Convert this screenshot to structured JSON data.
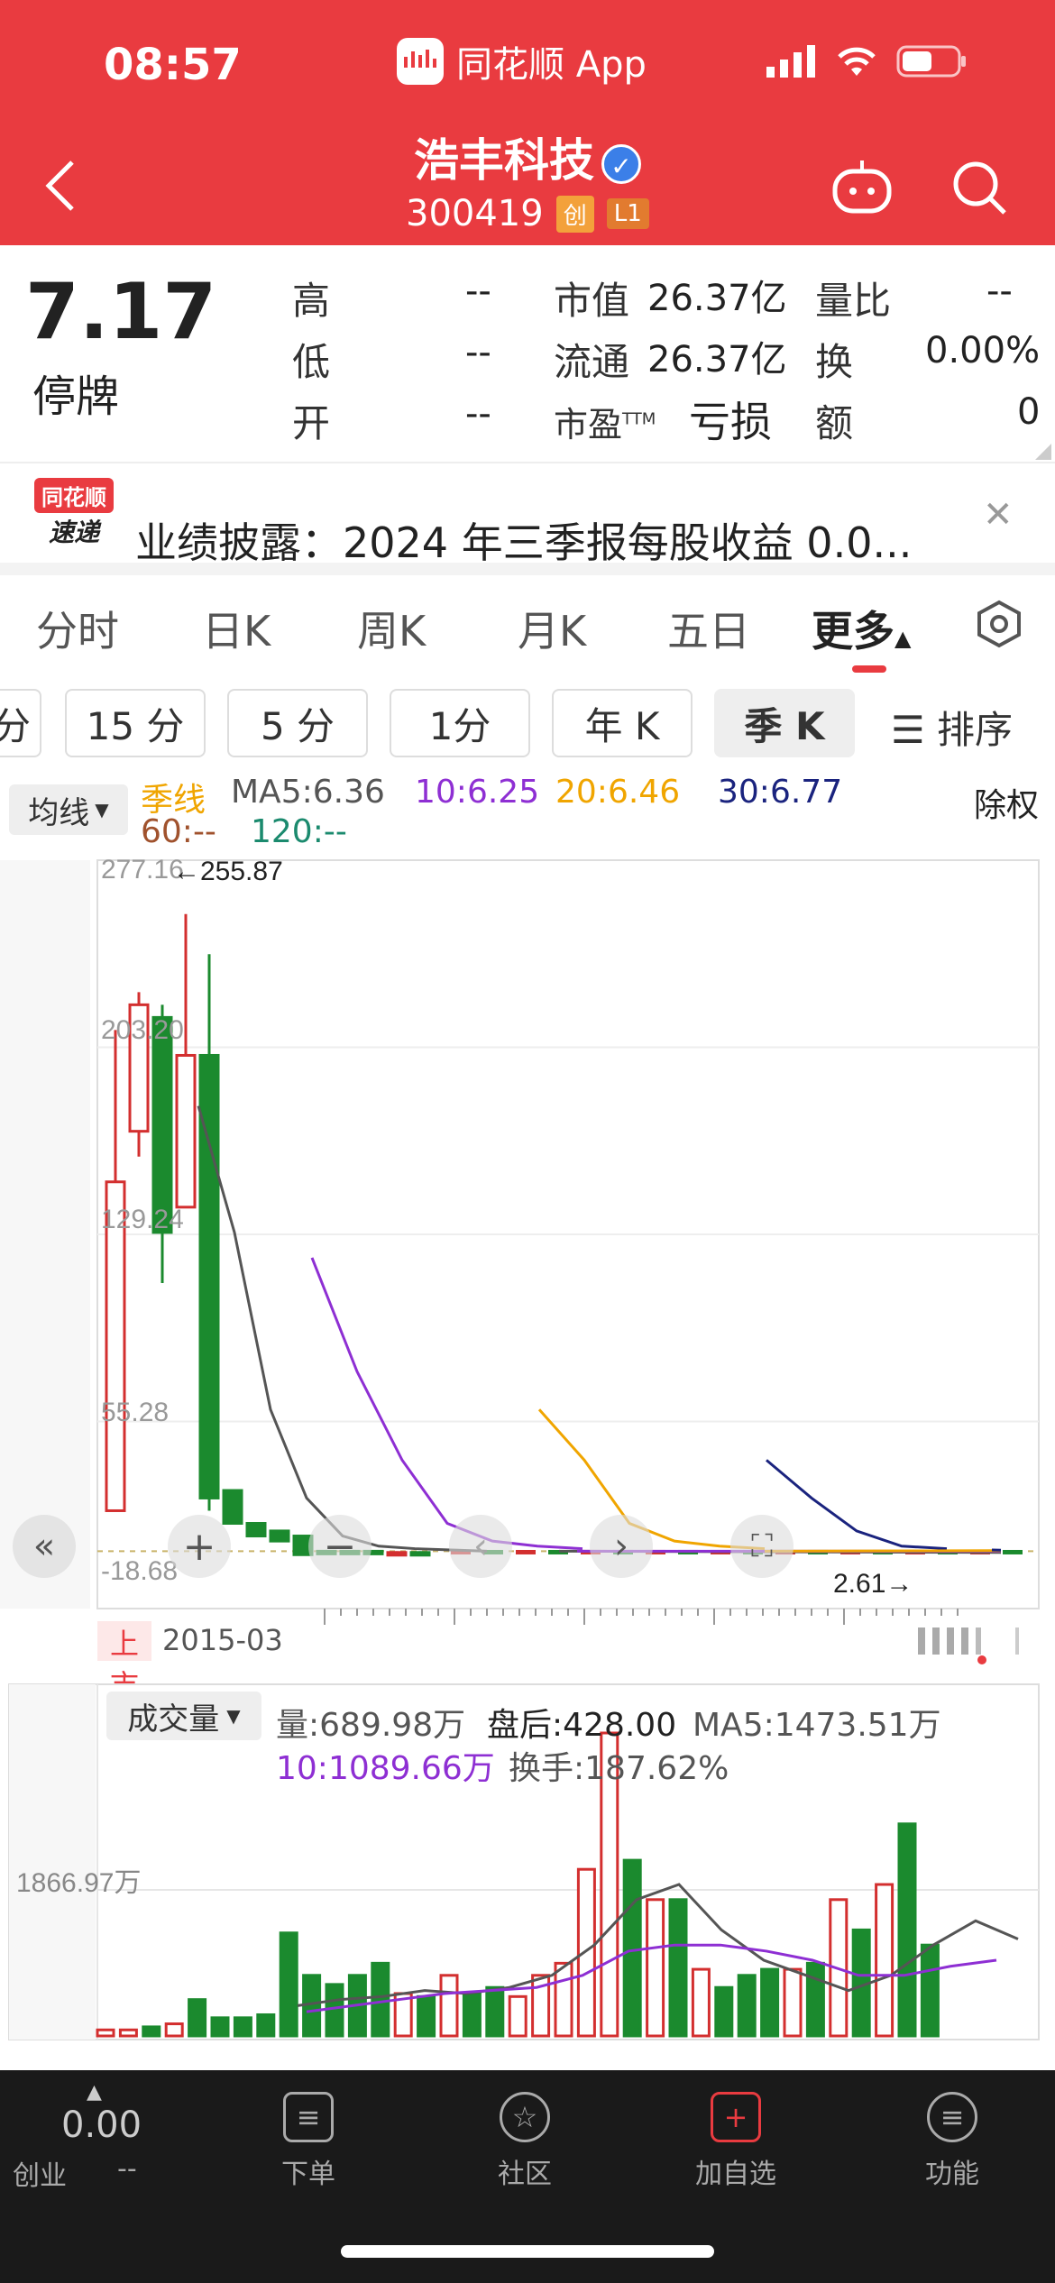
{
  "status_bar": {
    "time": "08:57",
    "app_name": "同花顺 App"
  },
  "header": {
    "stock_name": "浩丰科技",
    "stock_code": "300419",
    "tag_board": "创",
    "tag_level": "L1"
  },
  "quote": {
    "price": "7.17",
    "status": "停牌",
    "high_label": "高",
    "high_value": "--",
    "low_label": "低",
    "low_value": "--",
    "open_label": "开",
    "open_value": "--",
    "mcap_label": "市值",
    "mcap_value": "26.37亿",
    "float_label": "流通",
    "float_value": "26.37亿",
    "pe_label": "市盈",
    "pe_sup": "TTM",
    "pe_value": "亏损",
    "vr_label": "量比",
    "vr_value": "--",
    "turnover_label": "换",
    "turnover_value": "0.00%",
    "amount_label": "额",
    "amount_value": "0"
  },
  "news": {
    "logo_line1": "同花顺",
    "logo_line2": "速递",
    "text": "业绩披露：2024 年三季报每股收益 0.0..."
  },
  "tabs": [
    "分时",
    "日K",
    "周K",
    "月K",
    "五日",
    "更多"
  ],
  "periods": [
    "分",
    "15 分",
    "5 分",
    "1分",
    "年 K",
    "季 K"
  ],
  "sort_label": "排序",
  "chart_legend": {
    "ma_button": "均线",
    "line_type": "季线",
    "ma5": "MA5:6.36",
    "ma10": "10:6.25",
    "ma20": "20:6.46",
    "ma30": "30:6.77",
    "ma60": "60:--",
    "ma120": "120:--",
    "adjust": "除权"
  },
  "chart_labels": {
    "y_277": "277.16",
    "y_203": "203.20",
    "y_129": "129.24",
    "y_55": "55.28",
    "y_neg": "-18.68",
    "max_marker": "←255.87",
    "min_marker": "2.61→",
    "listed": "上市",
    "listed_date": "2015-03"
  },
  "colors": {
    "header": "#e93b40",
    "up": "#d32f2f",
    "down": "#1b8a2e",
    "ma5": "#555555",
    "ma10": "#8e2fd3",
    "ma20": "#f0a500",
    "ma30": "#1a237e"
  },
  "volume": {
    "label": "成交量",
    "vol": "量:689.98万",
    "after": "盘后:428.00",
    "ma5": "MA5:1473.51万",
    "ma10": "10:1089.66万",
    "turnover": "换手:187.62%",
    "y_label": "1866.97万"
  },
  "chart_data": {
    "type": "candlestick",
    "title": "",
    "ylim": [
      -18.68,
      277.16
    ],
    "candles": [
      {
        "o": 150,
        "c": 20,
        "h": 210,
        "l": 20,
        "up": true
      },
      {
        "o": 220,
        "c": 170,
        "h": 225,
        "l": 160,
        "up": true
      },
      {
        "o": 215,
        "c": 130,
        "h": 220,
        "l": 110,
        "up": false
      },
      {
        "o": 200,
        "c": 140,
        "h": 255.87,
        "l": 140,
        "up": true
      },
      {
        "o": 200,
        "c": 25,
        "h": 240,
        "l": 20,
        "up": false
      },
      {
        "o": 28,
        "c": 15,
        "h": 28,
        "l": 15,
        "up": false
      },
      {
        "o": 15,
        "c": 10,
        "h": 15,
        "l": 10,
        "up": false
      },
      {
        "o": 12,
        "c": 8,
        "h": 12,
        "l": 8,
        "up": false
      },
      {
        "o": 10,
        "c": 2.61,
        "h": 10,
        "l": 2.61,
        "up": false
      },
      {
        "o": 4,
        "c": 3.5,
        "h": 4.5,
        "l": 3,
        "up": false
      },
      {
        "o": 4,
        "c": 3,
        "h": 4,
        "l": 3,
        "up": false
      },
      {
        "o": 4,
        "c": 3,
        "h": 4,
        "l": 3,
        "up": false
      },
      {
        "o": 3,
        "c": 3.5,
        "h": 4,
        "l": 3,
        "up": true
      },
      {
        "o": 3.5,
        "c": 3,
        "h": 4,
        "l": 3,
        "up": false
      }
    ],
    "ma5": [
      180,
      130,
      60,
      25,
      10,
      6,
      5,
      4.5,
      4
    ],
    "ma10": [
      120,
      75,
      40,
      15,
      8,
      6,
      5
    ],
    "ma20": [
      60,
      40,
      15,
      8,
      6,
      5
    ],
    "ma30": [
      40,
      25,
      12,
      6,
      5
    ]
  },
  "volume_data": {
    "bars": [
      0.02,
      0.02,
      0.03,
      0.04,
      0.12,
      0.06,
      0.06,
      0.07,
      0.34,
      0.2,
      0.17,
      0.2,
      0.24,
      0.14,
      0.13,
      0.2,
      0.14,
      0.16,
      0.13,
      0.2,
      0.24,
      0.55,
      1.0,
      0.58,
      0.45,
      0.45,
      0.22,
      0.16,
      0.2,
      0.22,
      0.22,
      0.24,
      0.45,
      0.35,
      0.5,
      0.7,
      0.3
    ],
    "up": [
      true,
      true,
      false,
      true,
      false,
      false,
      false,
      false,
      false,
      false,
      false,
      false,
      false,
      true,
      false,
      true,
      false,
      false,
      true,
      true,
      true,
      true,
      true,
      false,
      true,
      false,
      true,
      false,
      false,
      false,
      true,
      false,
      true,
      false,
      true,
      false,
      false
    ],
    "ma5": [
      0.1,
      0.12,
      0.13,
      0.15,
      0.14,
      0.16,
      0.2,
      0.3,
      0.45,
      0.5,
      0.35,
      0.25,
      0.2,
      0.15,
      0.2,
      0.3,
      0.38,
      0.32
    ],
    "ma10": [
      0.08,
      0.1,
      0.12,
      0.14,
      0.15,
      0.16,
      0.2,
      0.28,
      0.3,
      0.3,
      0.28,
      0.25,
      0.2,
      0.2,
      0.23,
      0.25
    ]
  },
  "bottom_nav": {
    "index_value": "0.00",
    "index_label": "创业",
    "index_change": "--",
    "items": [
      "下单",
      "社区",
      "加自选",
      "功能"
    ]
  }
}
